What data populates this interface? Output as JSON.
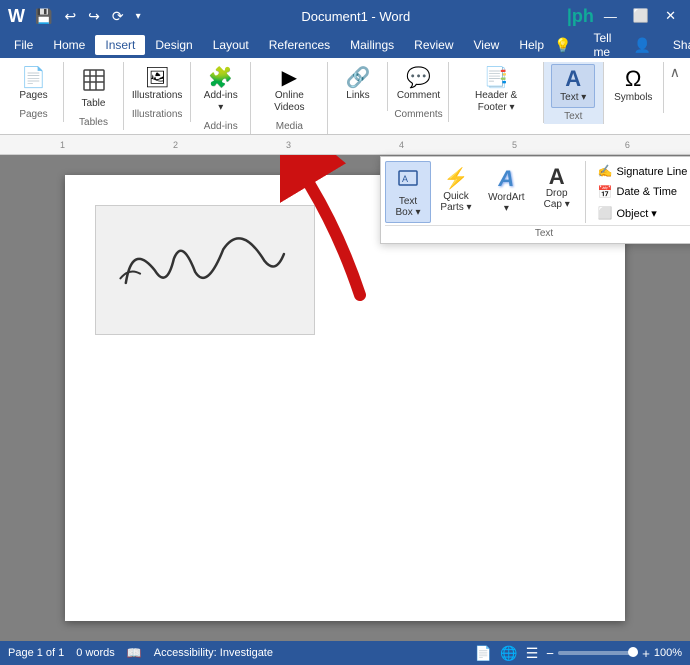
{
  "titleBar": {
    "appName": "Document1 - Word",
    "quickAccess": [
      "💾",
      "↩",
      "↪",
      "⟳",
      "▾"
    ],
    "windowControls": [
      "—",
      "⬜",
      "✕"
    ]
  },
  "menuBar": {
    "items": [
      "File",
      "Home",
      "Insert",
      "Design",
      "Layout",
      "References",
      "Mailings",
      "Review",
      "View",
      "Help"
    ],
    "active": "Insert",
    "tellMe": "Tell me",
    "share": "Share"
  },
  "ribbon": {
    "groups": [
      {
        "label": "Pages",
        "items": [
          {
            "icon": "📄",
            "label": "Pages"
          }
        ]
      },
      {
        "label": "Tables",
        "items": [
          {
            "icon": "⊞",
            "label": "Table"
          }
        ]
      },
      {
        "label": "Illustrations",
        "items": [
          {
            "icon": "🖼",
            "label": "Illustrations"
          }
        ]
      },
      {
        "label": "Add-ins",
        "items": [
          {
            "icon": "🧩",
            "label": "Add-ins ▾"
          }
        ]
      },
      {
        "label": "Media",
        "items": [
          {
            "icon": "▶",
            "label": "Online Videos"
          }
        ]
      },
      {
        "label": "",
        "items": [
          {
            "icon": "🔗",
            "label": "Links"
          }
        ]
      },
      {
        "label": "Comments",
        "items": [
          {
            "icon": "💬",
            "label": "Comment"
          }
        ]
      },
      {
        "label": "",
        "items": [
          {
            "icon": "📑",
            "label": "Header & Footer ▾"
          }
        ]
      },
      {
        "label": "Text",
        "items": [
          {
            "icon": "A",
            "label": "Text ▾",
            "active": true
          }
        ]
      },
      {
        "label": "",
        "items": [
          {
            "icon": "Ω",
            "label": "Symbols"
          }
        ]
      }
    ],
    "textPopup": {
      "buttons": [
        {
          "icon": "📦",
          "label": "Text\nBox ▾",
          "active": true
        },
        {
          "icon": "⚡",
          "label": "Quick\nParts ▾"
        },
        {
          "icon": "A",
          "label": "WordArt ▾",
          "wordart": true
        },
        {
          "icon": "A",
          "label": "Drop\nCap ▾",
          "dropcap": true
        }
      ],
      "sideButtons": [
        "Signature Line ▾",
        "Date & Time",
        "Object ▾"
      ],
      "groupLabel": "Text"
    }
  },
  "document": {
    "signature": "D' Sparrow",
    "pageInfo": "Page 1 of 1",
    "wordCount": "0 words",
    "accessibility": "Accessibility: Investigate",
    "zoom": "100%"
  },
  "arrow": {
    "label": "red-arrow-pointer"
  }
}
